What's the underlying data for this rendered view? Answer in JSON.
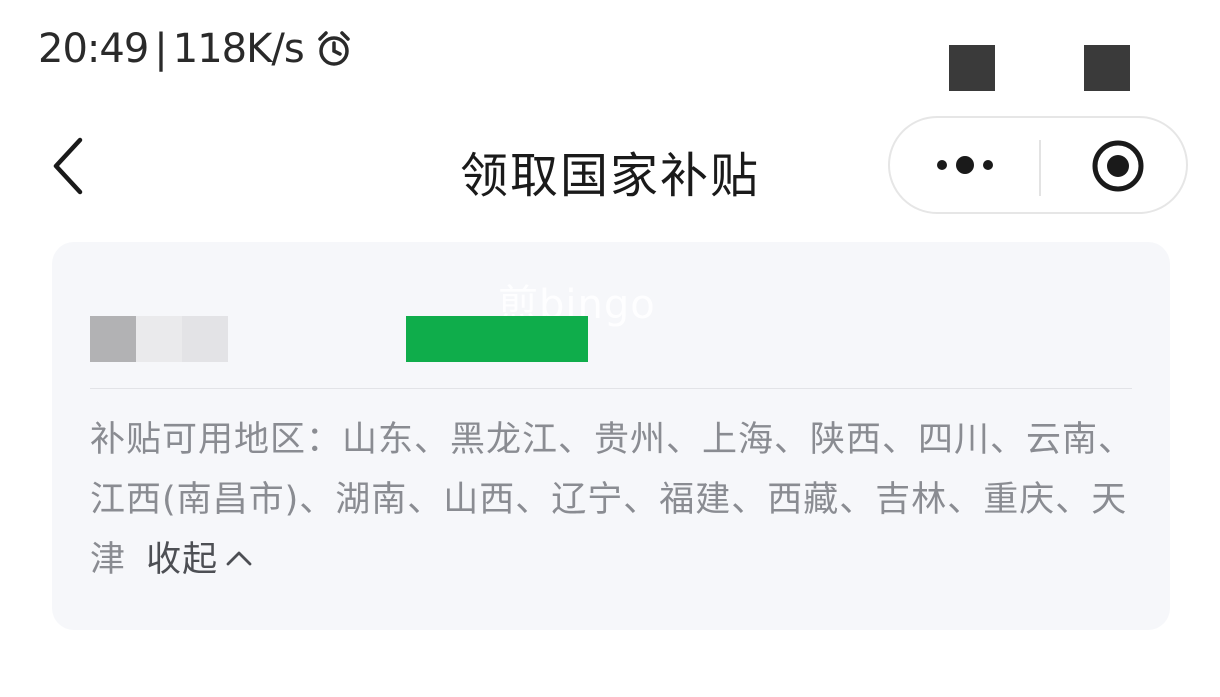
{
  "status_bar": {
    "time": "20:49",
    "separator": "|",
    "network_speed": "118K/s",
    "alarm_icon": "alarm-clock-icon"
  },
  "nav": {
    "back_icon": "chevron-left-icon",
    "title": "领取国家补贴",
    "more_icon": "more-dots-icon",
    "close_icon": "target-circle-icon"
  },
  "card": {
    "watermark": "煎bingo",
    "regions_label": "补贴可用地区：",
    "regions_text": "山东、黑龙江、贵州、上海、陕西、四川、云南、江西(南昌市)、湖南、山西、辽宁、福建、西藏、吉林、重庆、天津",
    "collapse_label": "收起",
    "collapse_icon": "chevron-up-icon",
    "highlight_color": "#0fad4b"
  }
}
